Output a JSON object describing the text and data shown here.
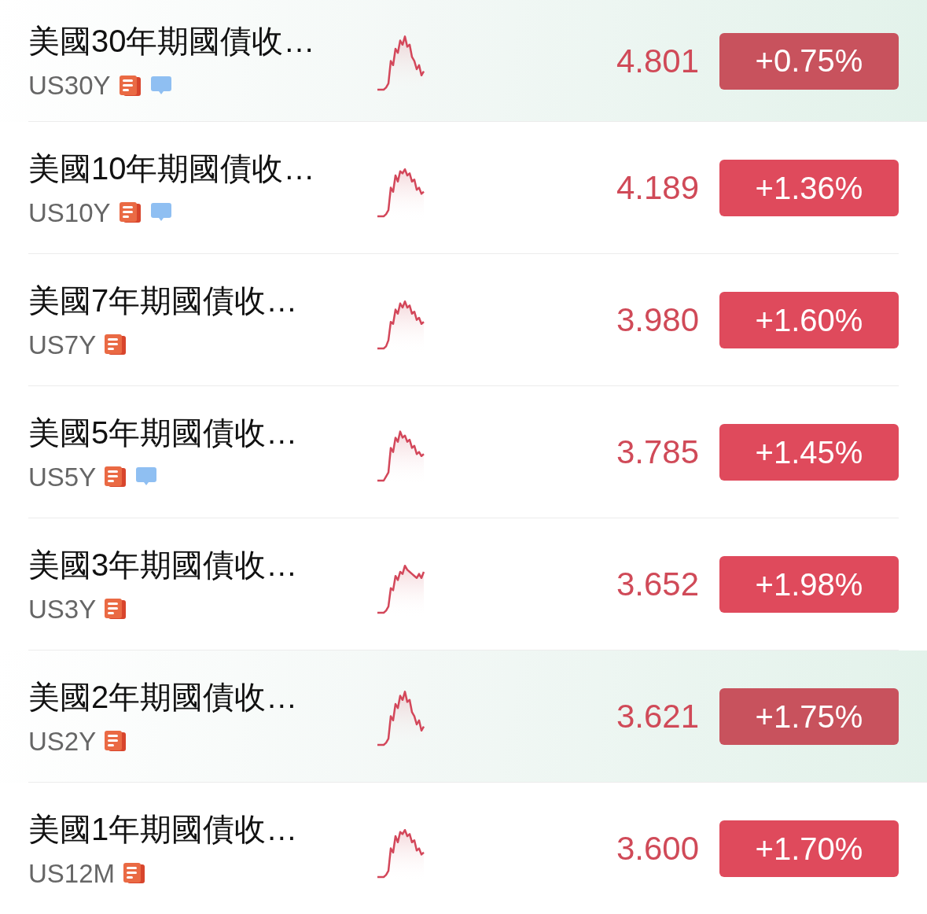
{
  "quotes": [
    {
      "name": "美國30年期國債收…",
      "code": "US30Y",
      "news": true,
      "comments": true,
      "price": "4.801",
      "change": "+0.75%",
      "highlighted": true
    },
    {
      "name": "美國10年期國債收…",
      "code": "US10Y",
      "news": true,
      "comments": true,
      "price": "4.189",
      "change": "+1.36%",
      "highlighted": false
    },
    {
      "name": "美國7年期國債收…",
      "code": "US7Y",
      "news": true,
      "comments": false,
      "price": "3.980",
      "change": "+1.60%",
      "highlighted": false
    },
    {
      "name": "美國5年期國債收…",
      "code": "US5Y",
      "news": true,
      "comments": true,
      "price": "3.785",
      "change": "+1.45%",
      "highlighted": false
    },
    {
      "name": "美國3年期國債收…",
      "code": "US3Y",
      "news": true,
      "comments": false,
      "price": "3.652",
      "change": "+1.98%",
      "highlighted": false
    },
    {
      "name": "美國2年期國債收…",
      "code": "US2Y",
      "news": true,
      "comments": false,
      "price": "3.621",
      "change": "+1.75%",
      "highlighted": true
    },
    {
      "name": "美國1年期國債收…",
      "code": "US12M",
      "news": true,
      "comments": false,
      "price": "3.600",
      "change": "+1.70%",
      "highlighted": false
    }
  ]
}
